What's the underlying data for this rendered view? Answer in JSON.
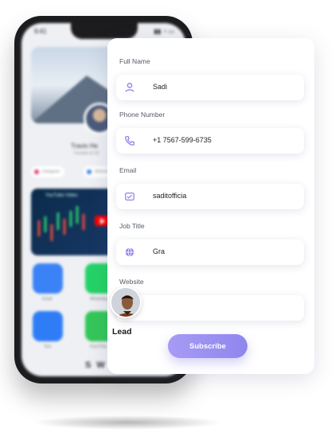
{
  "phone": {
    "status_time": "9:41",
    "status_icons": "▮▮ ◔ ▭",
    "profile_name": "Travis He",
    "profile_sub": "Founder & CE",
    "chips": [
      "Instagram",
      "Website"
    ],
    "video_title": "YouTube Video",
    "apps": [
      {
        "label": "Email",
        "color": "#3b82f6",
        "icon": "mail-icon"
      },
      {
        "label": "WhatsApp",
        "color": "#25d366",
        "icon": "whatsapp-icon"
      },
      {
        "label": "Text",
        "color": "#2f7df6",
        "icon": "message-icon"
      },
      {
        "label": "FaceTime",
        "color": "#34c759",
        "icon": "video-call-icon"
      }
    ],
    "brand_text": "S W I"
  },
  "form": {
    "fields": [
      {
        "label": "Full Name",
        "value": "Sadi",
        "icon": "user-icon"
      },
      {
        "label": "Phone Number",
        "value": "+1 7567-599-6735",
        "icon": "phone-icon"
      },
      {
        "label": "Email",
        "value": "saditofficia",
        "icon": "email-icon"
      },
      {
        "label": "Job Title",
        "value": "Gra",
        "icon": "globe-icon"
      },
      {
        "label": "Website",
        "value": "",
        "icon": "link-icon"
      }
    ],
    "subscribe_label": "Subscribe",
    "accent": "#8f86ee"
  },
  "lead": {
    "label": "Lead"
  }
}
